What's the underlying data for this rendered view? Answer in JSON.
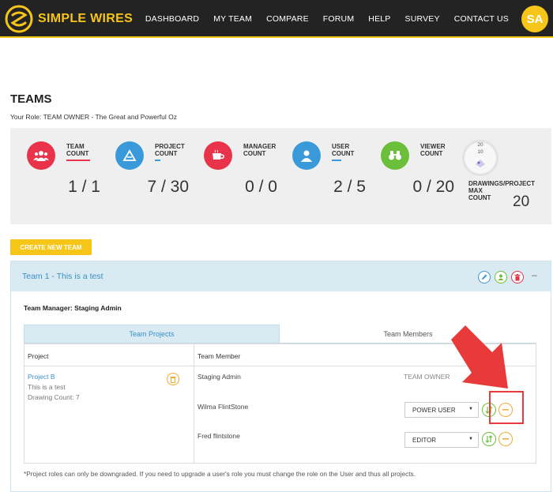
{
  "brand": {
    "name": "SIMPLE WIRES"
  },
  "nav": {
    "items": [
      "DASHBOARD",
      "MY TEAM",
      "COMPARE",
      "FORUM",
      "HELP",
      "SURVEY",
      "CONTACT US"
    ],
    "avatar_initials": "SA"
  },
  "page": {
    "title": "TEAMS",
    "role_line": "Your Role: TEAM OWNER - The Great and Powerful Oz"
  },
  "stats": [
    {
      "label_lines": [
        "TEAM",
        "COUNT"
      ],
      "value": "1 / 1",
      "icon": "users-icon",
      "color": "#e8334a"
    },
    {
      "label_lines": [
        "PROJECT",
        "COUNT"
      ],
      "value": "7 / 30",
      "icon": "project-icon",
      "color": "#3a9ad9"
    },
    {
      "label_lines": [
        "MANAGER",
        "COUNT"
      ],
      "value": "0 / 0",
      "icon": "coffee-icon",
      "color": "#e8334a"
    },
    {
      "label_lines": [
        "USER",
        "COUNT"
      ],
      "value": "2 / 5",
      "icon": "user-icon",
      "color": "#3a9ad9"
    },
    {
      "label_lines": [
        "VIEWER",
        "COUNT"
      ],
      "value": "0 / 20",
      "icon": "binoculars-icon",
      "color": "#6cbf3a"
    }
  ],
  "drawings": {
    "gauge_top": "20",
    "gauge_mid": "10",
    "label_lines": [
      "DRAWINGS/PROJECT",
      "MAX",
      "COUNT"
    ],
    "value": "20"
  },
  "create_button": "CREATE NEW TEAM",
  "team": {
    "title": "Team 1 - This is a test",
    "collapse": "–",
    "manager_line": "Team Manager: Staging Admin",
    "tabs": [
      "Team Projects",
      "Team Members"
    ],
    "columns": {
      "project": "Project",
      "member": "Team Member"
    },
    "project": {
      "name": "Project B",
      "description": "This is a test",
      "drawing_count": "Drawing Count: 7"
    },
    "members": [
      {
        "name": "Staging Admin",
        "role": "TEAM OWNER"
      },
      {
        "name": "Wilma FlintStone",
        "role": "POWER USER"
      },
      {
        "name": "Fred flintstone",
        "role": "EDITOR"
      }
    ],
    "footnote": "*Project roles can only be downgraded. If you need to upgrade a user's role you must change the role on the User and thus all projects."
  },
  "colors": {
    "accent": "#f5c518",
    "link": "#3a8fc7",
    "danger": "#e8334a",
    "success": "#6cbf3a",
    "warning": "#f0a92f",
    "annotation": "#e83a3a"
  }
}
